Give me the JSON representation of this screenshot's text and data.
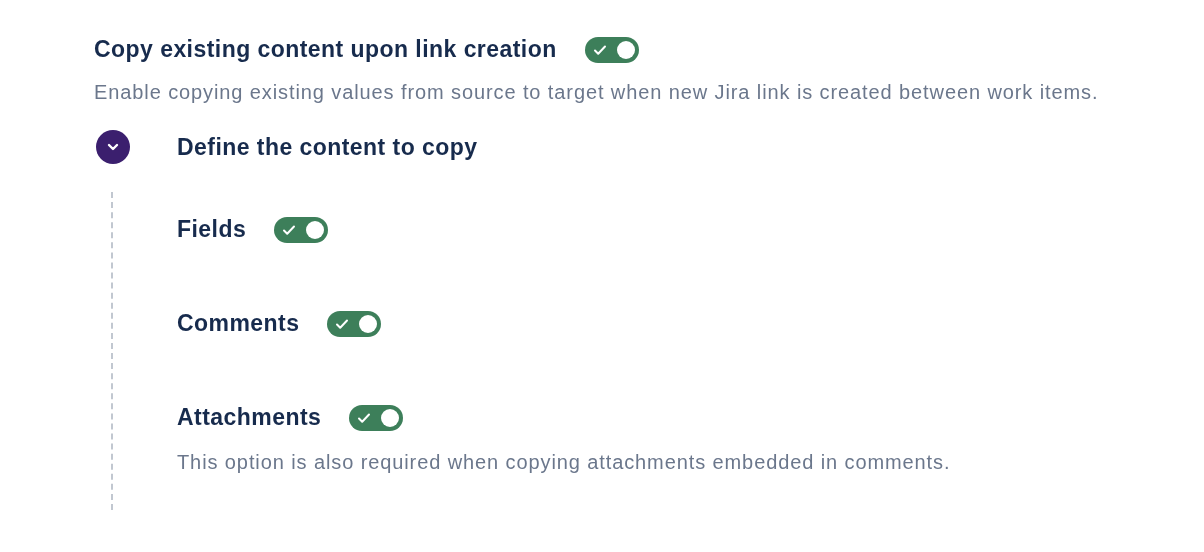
{
  "main_setting": {
    "title": "Copy existing content upon link creation",
    "on": true,
    "description": "Enable copying existing values from source to target when new Jira link is created between work items."
  },
  "section": {
    "title": "Define the content to copy",
    "expanded": true,
    "items": [
      {
        "label": "Fields",
        "on": true
      },
      {
        "label": "Comments",
        "on": true
      },
      {
        "label": "Attachments",
        "on": true,
        "note": "This option is also required when copying attachments embedded in comments."
      }
    ]
  }
}
